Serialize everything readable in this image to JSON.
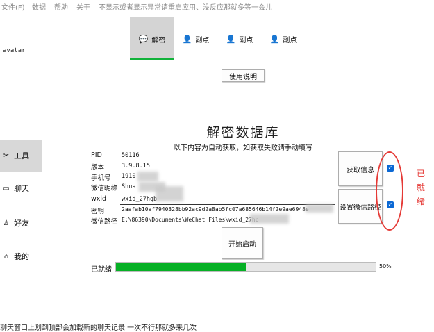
{
  "menubar": [
    "文件(F)",
    "数据",
    "帮助",
    "关于",
    "不显示或者显示异常请重启应用、没反应那就多等一会儿"
  ],
  "avatar": "avatar",
  "sidebar": [
    {
      "label": "工具",
      "icon": "tools-icon",
      "selected": true
    },
    {
      "label": "聊天",
      "icon": "chat-icon"
    },
    {
      "label": "好友",
      "icon": "friends-icon"
    },
    {
      "label": "我的",
      "icon": "home-icon"
    }
  ],
  "tabs": [
    {
      "label": "解密",
      "icon": "chat-bubble-icon",
      "selected": true
    },
    {
      "label": "副点",
      "icon": "user-icon"
    },
    {
      "label": "副点",
      "icon": "user-icon"
    },
    {
      "label": "副点",
      "icon": "user-icon"
    }
  ],
  "help_button": "使用说明",
  "title": "解密数据库",
  "subtitle": "以下内容为自动获取，如获取失败请手动填写",
  "fields": [
    {
      "label": "PID",
      "value": "50116"
    },
    {
      "label": "版本",
      "value": "3.9.8.15"
    },
    {
      "label": "手机号",
      "value": "1910"
    },
    {
      "label": "微信昵称",
      "value": "Shua"
    },
    {
      "label": "wxid",
      "value": "wxid_27hqb"
    },
    {
      "label": "密钥",
      "value": "2aafab10af7940328bb92ac9d2a8ab5fc07a685646b14f2e9ae6948e"
    },
    {
      "label": "微信路径",
      "value": "E:\\86390\\Documents\\WeChat Files\\wxid_27hc"
    }
  ],
  "get_info_button": "获取信息",
  "set_path_button": "设置微信路径",
  "annotation": "已就绪",
  "start_button": "开始启动",
  "status": "已就绪",
  "progress": {
    "value": 0.5,
    "label": "50%"
  },
  "footer": "聊天窗口上划到顶部会加载新的聊天记录 一次不行那就多来几次",
  "colors": {
    "progress_fill": "#06b025",
    "tab_underline": "#11b23a",
    "annotation_red": "#e53935",
    "checkbox_blue": "#0b68d4"
  }
}
